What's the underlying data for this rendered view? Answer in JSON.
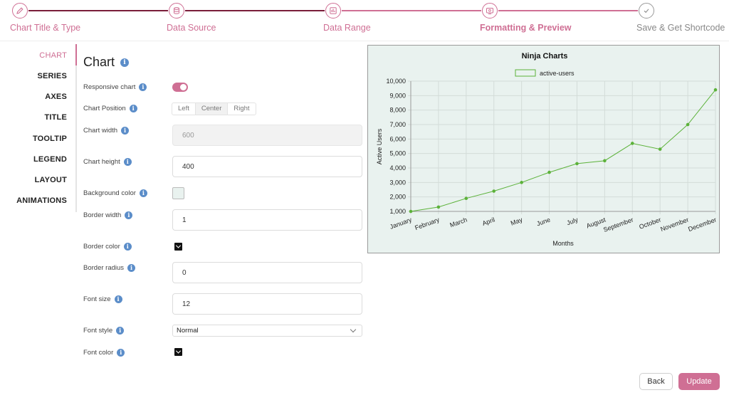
{
  "stepper": {
    "steps": [
      {
        "label": "Chart Title & Type",
        "icon": "pencil-icon",
        "state": "done"
      },
      {
        "label": "Data Source",
        "icon": "database-icon",
        "state": "done"
      },
      {
        "label": "Data Range",
        "icon": "range-icon",
        "state": "done"
      },
      {
        "label": "Formatting & Preview",
        "icon": "preview-icon",
        "state": "active"
      },
      {
        "label": "Save & Get Shortcode",
        "icon": "check-icon",
        "state": "pending"
      }
    ],
    "color_done": "#cf6f94",
    "color_active_line": "#7a1e3a",
    "color_pending": "#9a9a9a"
  },
  "tabs": [
    "CHART",
    "SERIES",
    "AXES",
    "TITLE",
    "TOOLTIP",
    "LEGEND",
    "LAYOUT",
    "ANIMATIONS"
  ],
  "active_tab": "CHART",
  "panel": {
    "title": "Chart",
    "responsive_label": "Responsive chart",
    "responsive_on": true,
    "position_label": "Chart Position",
    "position_options": [
      "Left",
      "Center",
      "Right"
    ],
    "position_selected": "Center",
    "width_label": "Chart width",
    "width_value": "600",
    "height_label": "Chart height",
    "height_value": "400",
    "bg_label": "Background color",
    "bg_color": "#e9f2ef",
    "border_width_label": "Border width",
    "border_width_value": "1",
    "border_color_label": "Border color",
    "border_color": "#111111",
    "border_radius_label": "Border radius",
    "border_radius_value": "0",
    "font_size_label": "Font size",
    "font_size_value": "12",
    "font_style_label": "Font style",
    "font_style_value": "Normal",
    "font_color_label": "Font color",
    "font_color": "#111111"
  },
  "buttons": {
    "back": "Back",
    "update": "Update"
  },
  "colors": {
    "accent": "#cf6f94",
    "info": "#5b8dc9",
    "series": "#5cb23a",
    "chart_bg": "#e9f2ef"
  },
  "chart_data": {
    "type": "line",
    "title": "Ninja Charts",
    "xlabel": "Months",
    "ylabel": "Active Users",
    "categories": [
      "January",
      "February",
      "March",
      "April",
      "May",
      "June",
      "July",
      "August",
      "September",
      "October",
      "November",
      "December"
    ],
    "series": [
      {
        "name": "active-users",
        "values": [
          1000,
          1300,
          1900,
          2400,
          3000,
          3700,
          4300,
          4500,
          5700,
          5300,
          7000,
          9400
        ]
      }
    ],
    "ylim": [
      1000,
      10000
    ],
    "yticks": [
      "1,000",
      "2,000",
      "3,000",
      "4,000",
      "5,000",
      "6,000",
      "7,000",
      "8,000",
      "9,000",
      "10,000"
    ],
    "grid": true,
    "legend": "top-center"
  }
}
